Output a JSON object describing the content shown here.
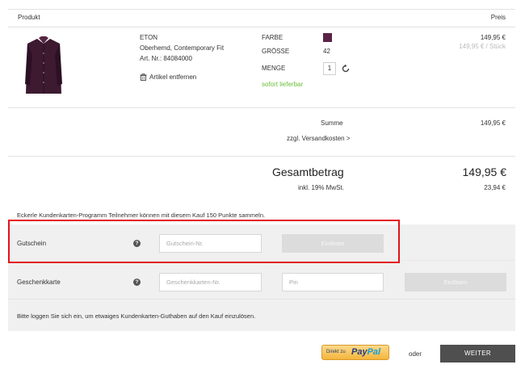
{
  "header": {
    "product_label": "Produkt",
    "price_label": "Preis"
  },
  "item": {
    "brand": "ETON",
    "name": "Oberhemd, Contemporary Fit",
    "article": "Art. Nr.: 84084000",
    "remove_label": "Artikel entfernen",
    "color_label": "FARBE",
    "color_value": "#5a2346",
    "size_label": "GRÖSSE",
    "size_value": "42",
    "qty_label": "MENGE",
    "qty_value": "1",
    "availability": "sofort lieferbar",
    "price": "149,95 €",
    "unit_price": "149,95 € / Stück"
  },
  "summary": {
    "sum_label": "Summe",
    "sum_value": "149,95 €",
    "shipping_link": "zzgl. Versandkosten >",
    "total_label": "Gesamtbetrag",
    "total_value": "149,95 €",
    "vat_label": "inkl. 19% MwSt.",
    "vat_value": "23,94 €"
  },
  "loyalty_note": "Eckerle Kundenkarten-Programm Teilnehmer können mit diesem Kauf 150 Punkte sammeln.",
  "voucher": {
    "label": "Gutschein",
    "placeholder": "Gutschein-Nr.",
    "button": "Einlösen"
  },
  "giftcard": {
    "label": "Geschenkkarte",
    "placeholder": "Geschenkkarten-Nr.",
    "pin_placeholder": "Pin",
    "button": "Einlösen"
  },
  "login_note": "Bitte loggen Sie sich ein, um etwaiges Kundenkarten-Guthaben auf den Kauf einzulösen.",
  "checkout": {
    "paypal_prefix": "Direkt zu",
    "paypal_logo_a": "Pay",
    "paypal_logo_b": "Pal",
    "or_label": "oder",
    "continue_label": "WEITER"
  },
  "colors": {
    "accent_dark": "#4f4f4f",
    "highlight": "#e3121b",
    "available": "#6abf3c"
  }
}
